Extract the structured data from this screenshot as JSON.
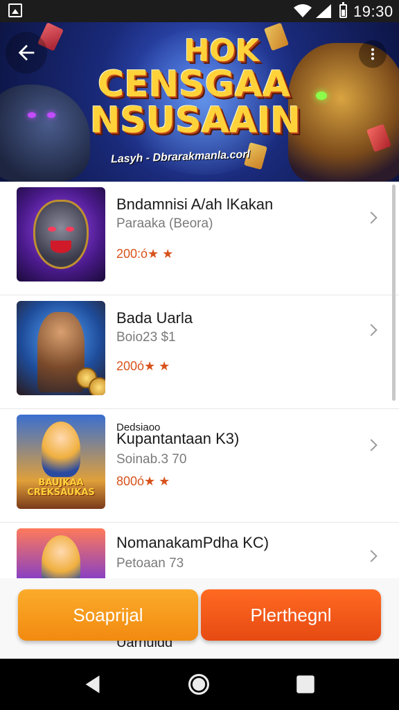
{
  "status_bar": {
    "time": "19:30",
    "icons": [
      "app-notification-icon",
      "wifi-icon",
      "signal-icon",
      "battery-icon"
    ]
  },
  "hero": {
    "title_line1": "HOK",
    "title_line2": "CENSGAA",
    "title_line3": "NSUSAAIN",
    "tagline": "Lasyh - Dbrarakmanla.corl",
    "back_icon": "arrow-back-icon",
    "more_icon": "more-vert-icon"
  },
  "games": [
    {
      "name": "Bndamnisi A/ah lKakan",
      "subtitle": "Paraaka (Beora)",
      "rating": "200:ó★ ★"
    },
    {
      "name": "Bada Uarla",
      "subtitle": "Boio23 $1",
      "rating": "200ó★ ★"
    },
    {
      "kicker": "Dedsiaoo",
      "name": "Kupantantaan K3)",
      "subtitle": "Soinab.3 70",
      "rating": "800ó★ ★",
      "thumb_text": "BAUJKAA CREKSAUKAS"
    },
    {
      "name": "NomanakamPdha KC)",
      "subtitle": "Petoaan 73"
    }
  ],
  "list_peek_text": "Uarnuidd",
  "actions": {
    "secondary_label": "Soaprijal",
    "primary_label": "Plerthegnl"
  },
  "colors": {
    "accent_orange": "#f28a10",
    "accent_red_orange": "#e64a12",
    "rating_color": "#d8521b"
  },
  "nav_bar": {
    "icons": [
      "nav-back-icon",
      "nav-home-icon",
      "nav-recents-icon"
    ]
  }
}
